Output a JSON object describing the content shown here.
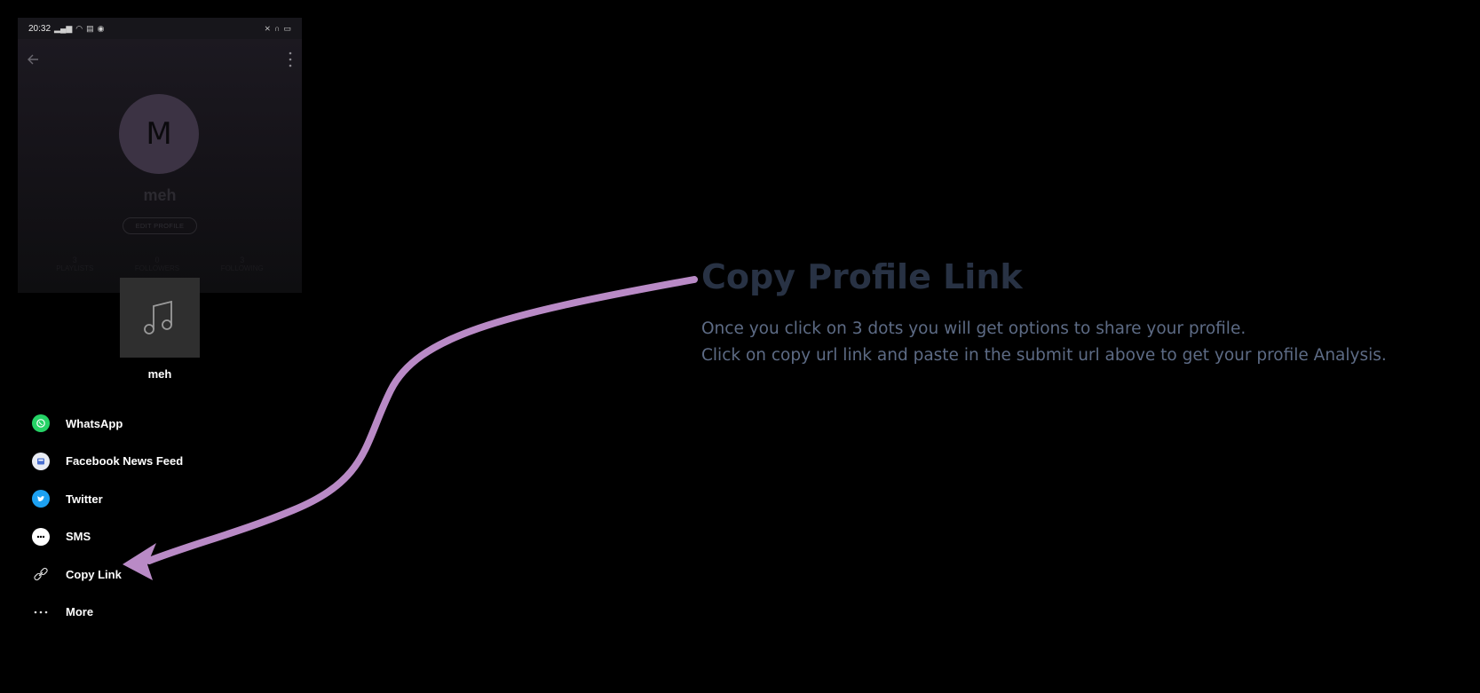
{
  "phone": {
    "status_bar": {
      "time": "20:32",
      "icons": [
        "signal-icon",
        "wifi-icon",
        "data-icon",
        "nfc-icon",
        "silent-icon",
        "headphones-icon",
        "battery-icon"
      ]
    },
    "profile": {
      "avatar_letter": "M",
      "name": "meh",
      "edit_label": "EDIT PROFILE"
    },
    "stats": [
      {
        "num": "3",
        "label": "PLAYLISTS"
      },
      {
        "num": "0",
        "label": "FOLLOWERS"
      },
      {
        "num": "3",
        "label": "FOLLOWING"
      }
    ]
  },
  "playlist": {
    "name": "meh",
    "icon": "music-note-icon"
  },
  "share_options": [
    {
      "label": "WhatsApp",
      "icon": "whatsapp-icon",
      "color": "#25D366"
    },
    {
      "label": "Facebook News Feed",
      "icon": "facebook-news-feed-icon",
      "color": "#e9ecf3"
    },
    {
      "label": "Twitter",
      "icon": "twitter-icon",
      "color": "#1DA1F2"
    },
    {
      "label": "SMS",
      "icon": "sms-icon",
      "color": "#ffffff"
    },
    {
      "label": "Copy Link",
      "icon": "link-icon",
      "color": "#ffffff"
    },
    {
      "label": "More",
      "icon": "more-horizontal-icon",
      "color": "#ffffff"
    }
  ],
  "instructions": {
    "heading": "Copy Profile Link",
    "line1": "Once you click on 3 dots you will get options to share your profile.",
    "line2": "Click on copy url link and paste in the submit url above to get your profile Analysis."
  },
  "colors": {
    "arrow": "#b98ac6",
    "heading": "#283244",
    "text": "#5d6b85",
    "background": "#000000"
  }
}
